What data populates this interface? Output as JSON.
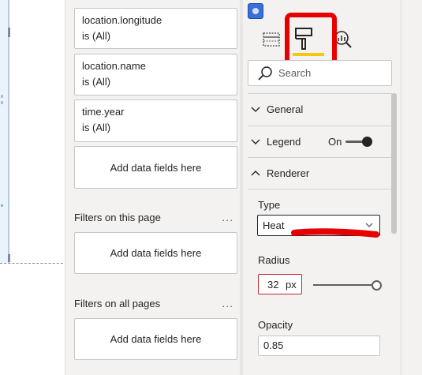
{
  "canvas": {
    "strip_texts": [
      "n",
      "n",
      "e"
    ]
  },
  "filters": {
    "cards": [
      {
        "field": "location.longitude",
        "value": "is (All)"
      },
      {
        "field": "location.name",
        "value": "is (All)"
      },
      {
        "field": "time.year",
        "value": "is (All)"
      }
    ],
    "visual_add": "Add data fields here",
    "page_title": "Filters on this page",
    "page_add": "Add data fields here",
    "all_title": "Filters on all pages",
    "all_add": "Add data fields here",
    "more": "..."
  },
  "viz": {
    "tabs": [
      {
        "name": "fields",
        "icon": "table-icon"
      },
      {
        "name": "format",
        "icon": "paint-roller-icon"
      },
      {
        "name": "analytics",
        "icon": "magnifier-chart-icon"
      }
    ],
    "search_placeholder": "Search",
    "sections": {
      "general": "General",
      "legend": "Legend",
      "legend_toggle": "On",
      "renderer": "Renderer"
    },
    "renderer": {
      "type_label": "Type",
      "type_value": "Heat",
      "radius_label": "Radius",
      "radius_value": "32",
      "radius_unit": "px",
      "radius_slider_fraction": 1.0,
      "opacity_label": "Opacity",
      "opacity_value": "0.85"
    }
  },
  "colors": {
    "annotation_red": "#e60000",
    "active_tab_underline": "#f2c811",
    "pane_background": "#f3f2f1",
    "invalid_border": "#c0282e"
  }
}
